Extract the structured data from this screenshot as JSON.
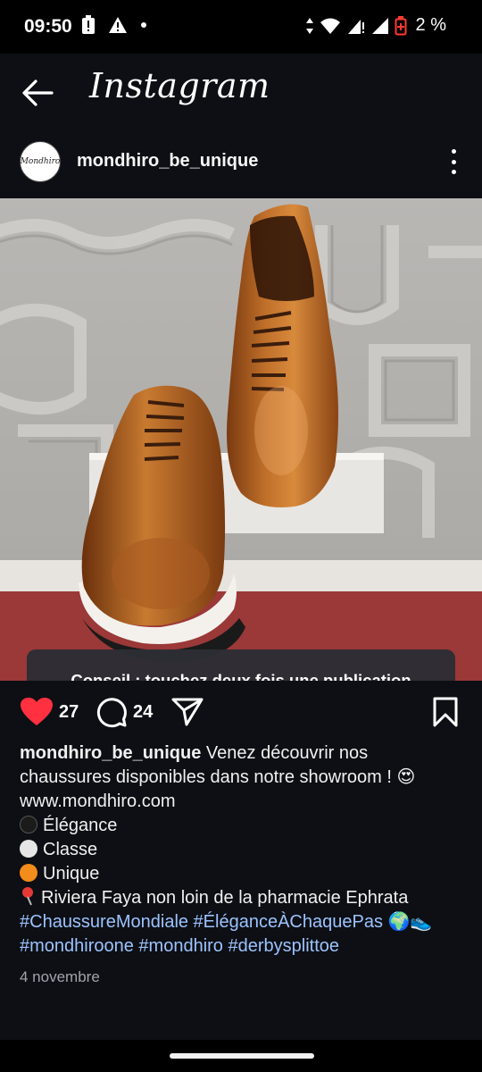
{
  "status_bar": {
    "time": "09:50",
    "battery_percent": "2 %"
  },
  "app": {
    "title": "Instagram"
  },
  "post": {
    "username": "mondhiro_be_unique",
    "avatar_text": "Mondhiro",
    "tip_toast": "Conseil : touchez deux fois une publication pour ajouter un J’aime.",
    "likes": "27",
    "comments": "24",
    "liked": true,
    "caption": {
      "intro": "Venez découvrir nos",
      "line2": "chaussures disponibles dans notre showroom !",
      "line2_emoji": "😍",
      "url": "www.mondhiro.com",
      "item1": "Élégance",
      "item2": "Classe",
      "item3": "Unique",
      "location": "Riviera Faya non loin de la pharmacie Ephrata",
      "hashtags1": "#ChaussureMondiale #ÉléganceÀChaquePas",
      "hashtags1_emoji": "🌍👟",
      "hashtags2": "#mondhiroone #mondhiro #derbysplittoe"
    },
    "date": "4 novembre"
  },
  "colors": {
    "like_red": "#ff3040",
    "hashtag_blue": "#9cc3ff",
    "background": "#0d0f14"
  }
}
